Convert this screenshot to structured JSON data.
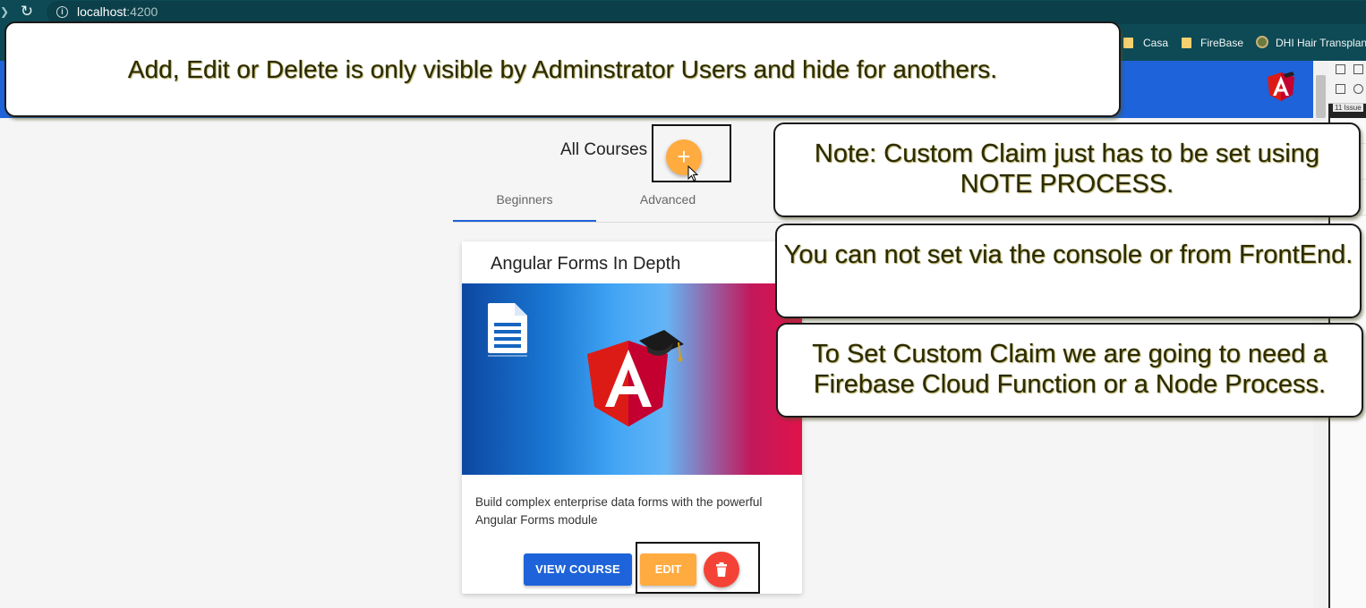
{
  "browser": {
    "url_host": "localhost",
    "url_port": ":4200",
    "bookmarks": [
      {
        "label": "Casa"
      },
      {
        "label": "FireBase"
      },
      {
        "label": "DHI Hair Transplant"
      }
    ]
  },
  "devtools": {
    "issues_badge": "11 Issue"
  },
  "page": {
    "title": "All Courses",
    "add_button": "+",
    "tabs": [
      {
        "label": "Beginners",
        "active": true
      },
      {
        "label": "Advanced",
        "active": false
      }
    ]
  },
  "course_card": {
    "title": "Angular Forms In Depth",
    "description": "Build complex enterprise data forms with the powerful Angular Forms module",
    "view_button": "VIEW COURSE",
    "edit_button": "EDIT",
    "delete_icon": "trash-icon"
  },
  "annotations": {
    "top": "Add, Edit or Delete is only visible by Adminstrator Users and hide for anothers.",
    "note_1": "Note: Custom Claim just has to be set using NOTE PROCESS.",
    "note_2": "You can not set via the console or from FrontEnd.",
    "note_3": "To Set  Custom Claim we are going to need a Firebase Cloud Function or a Node Process."
  },
  "colors": {
    "toolbar": "#1e63d9",
    "browser_chrome": "#0d4a55",
    "accent_orange": "#ffab40",
    "warn_red": "#f44336"
  }
}
